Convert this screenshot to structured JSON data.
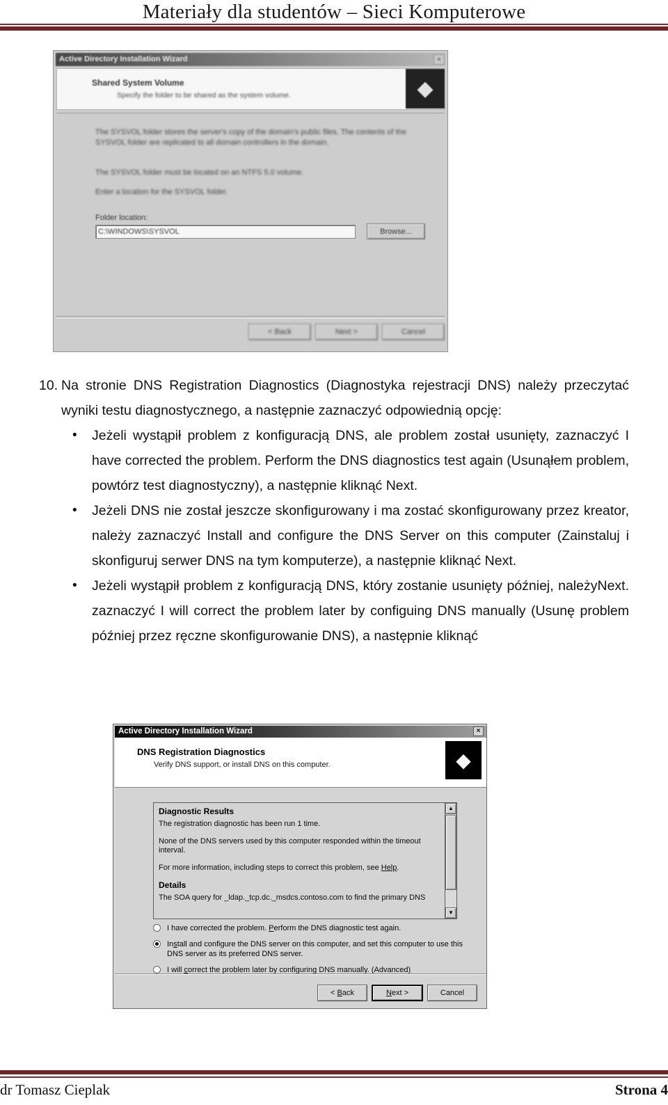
{
  "header": {
    "title": "Materiały dla studentów – Sieci Komputerowe",
    "rule_color": "#6e2626"
  },
  "screenshot_top": {
    "window_title": "Active Directory Installation Wizard",
    "close_label": "×",
    "banner_heading": "Shared System Volume",
    "banner_subtitle": "Specify the folder to be shared as the system volume.",
    "body_paragraph_1": "The SYSVOL folder stores the server's copy of the domain's public files. The contents of the SYSVOL folder are replicated to all domain controllers in the domain.",
    "body_paragraph_2": "The SYSVOL folder must be located on an NTFS 5.0 volume.",
    "body_paragraph_3": "Enter a location for the SYSVOL folder.",
    "folder_label": "Folder location:",
    "folder_value": "C:\\WINDOWS\\SYSVOL",
    "browse_label": "Browse...",
    "buttons": [
      "< Back",
      "Next >",
      "Cancel"
    ],
    "icon": "wizard-network-icon"
  },
  "body": {
    "numbered_item": {
      "number": "10.",
      "text": "Na stronie DNS Registration Diagnostics (Diagnostyka rejestracji DNS) należy przeczytać wyniki testu diagnostycznego, a następnie zaznaczyć odpowiednią opcję:"
    },
    "bullets": [
      {
        "text": "Jeżeli wystąpił problem z konfiguracją DNS, ale problem został usunięty, zaznaczyć I have corrected the problem.  Perform the DNS diagnostics test again (Usunąłem problem, powtórz test diagnostyczny), a następnie kliknąć Next."
      },
      {
        "text": "Jeżeli DNS nie został jeszcze skonfigurowany i ma zostać skonfigurowany przez kreator, należy zaznaczyć Install and configure the DNS Server on this computer (Zainstaluj i skonfiguruj serwer DNS na tym komputerze), a następnie kliknąć Next."
      },
      {
        "text": "Jeżeli wystąpił problem z konfiguracją DNS, który zostanie usunięty później, należy zaznaczyć I will correct the problem later by configuing DNS manually (Usunę problem później przez ręczne skonfigurowanie DNS), a następnie kliknąć",
        "tail_right": "Next."
      }
    ]
  },
  "screenshot_bottom": {
    "window_title": "Active Directory Installation Wizard",
    "close_label": "×",
    "banner_heading": "DNS Registration Diagnostics",
    "banner_subtitle": "Verify DNS support, or install DNS on this computer.",
    "icon": "wizard-network-icon",
    "results": {
      "heading_1": "Diagnostic Results",
      "line_1": "The registration diagnostic has been run 1 time.",
      "line_2": "None of the DNS servers used by this computer responded within the timeout interval.",
      "line_3_pre": "For more information, including steps to correct this problem, see ",
      "line_3_link": "Help",
      "line_3_post": ".",
      "heading_2": "Details",
      "line_4": "The SOA query for _ldap._tcp.dc._msdcs.contoso.com to find the primary DNS",
      "scroll_up": "▲",
      "scroll_down": "▼"
    },
    "options": [
      {
        "label_pre": "I have corrected the problem.  ",
        "label_accel": "P",
        "label_post": "erform the DNS diagnostic test again.",
        "selected": false
      },
      {
        "label_pre": "In",
        "label_accel": "s",
        "label_post": "tall and configure the DNS server on this computer, and set this computer to use this DNS server as its preferred DNS server.",
        "selected": true
      },
      {
        "label_pre": "I will ",
        "label_accel": "c",
        "label_post": "orrect the problem later by configuring DNS manually. (Advanced)",
        "selected": false
      }
    ],
    "buttons": [
      {
        "pre": "< ",
        "accel": "B",
        "post": "ack",
        "default": false
      },
      {
        "pre": "",
        "accel": "N",
        "post": "ext >",
        "default": true
      },
      {
        "pre": "Cancel",
        "accel": "",
        "post": "",
        "default": false
      }
    ]
  },
  "footer": {
    "author": "dr Tomasz Cieplak",
    "page": "Strona 4"
  }
}
